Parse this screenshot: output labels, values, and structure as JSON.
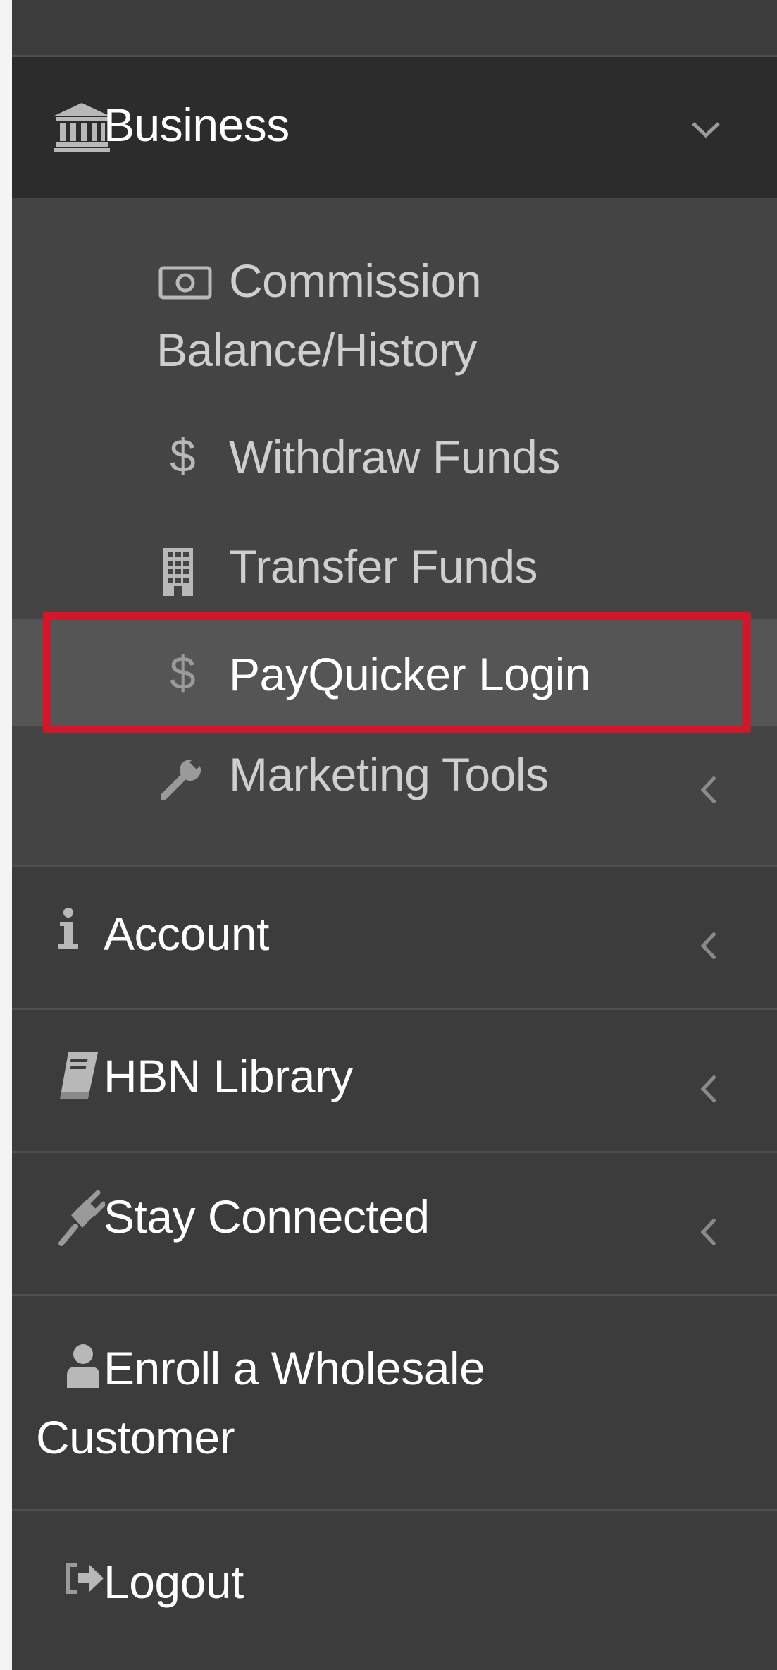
{
  "menu": {
    "top_item": {
      "label": ""
    },
    "business": {
      "label": "Business",
      "icon": "bank-icon",
      "expanded": true,
      "children": [
        {
          "label_line1": "Commission",
          "label_line2": "Balance/History",
          "icon": "money-bill-icon"
        },
        {
          "label": "Withdraw Funds",
          "icon": "dollar-icon"
        },
        {
          "label": "Transfer Funds",
          "icon": "building-icon"
        },
        {
          "label": "PayQuicker Login",
          "icon": "dollar-icon",
          "selected": true
        },
        {
          "label": "Marketing Tools",
          "icon": "wrench-icon"
        }
      ]
    },
    "items": [
      {
        "label": "Account",
        "icon": "info-icon"
      },
      {
        "label": "HBN Library",
        "icon": "book-icon"
      },
      {
        "label": "Stay Connected",
        "icon": "plug-icon"
      },
      {
        "label_line1": "Enroll a Wholesale",
        "label_line2": "Customer",
        "icon": "user-icon"
      },
      {
        "label": "Logout",
        "icon": "sign-out-icon"
      }
    ]
  },
  "colors": {
    "sidebar_bg": "#3c3c3c",
    "header_bg": "#2c2c2c",
    "submenu_bg": "#444444",
    "selected_bg": "#555555",
    "highlight_border": "#d3172b",
    "text": "#ffffff",
    "subtext": "#cfcfcf",
    "icon": "#b8b8b8"
  }
}
